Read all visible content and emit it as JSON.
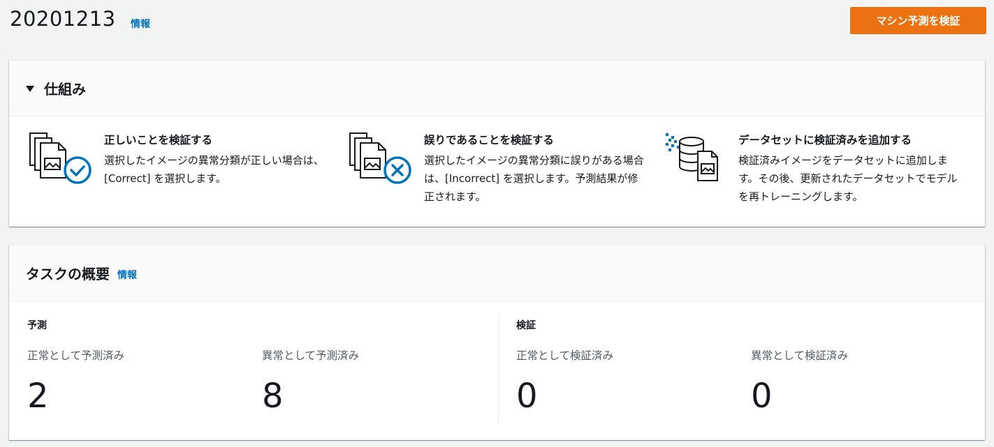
{
  "header": {
    "title": "20201213",
    "info": "情報",
    "action_button": "マシン予測を検証"
  },
  "how_it_works": {
    "title": "仕組み",
    "steps": [
      {
        "icon": "verify-correct-icon",
        "title": "正しいことを検証する",
        "description": "選択したイメージの異常分類が正しい場合は、[Correct] を選択します。"
      },
      {
        "icon": "verify-incorrect-icon",
        "title": "誤りであることを検証する",
        "description": "選択したイメージの異常分類に誤りがある場合は、[Incorrect] を選択します。予測結果が修正されます。"
      },
      {
        "icon": "add-to-dataset-icon",
        "title": "データセットに検証済みを追加する",
        "description": "検証済みイメージをデータセットに追加します。その後、更新されたデータセットでモデルを再トレーニングします。"
      }
    ]
  },
  "task_overview": {
    "title": "タスクの概要",
    "info": "情報",
    "prediction": {
      "label": "予測",
      "normal_label": "正常として予測済み",
      "normal_value": "2",
      "anomaly_label": "異常として予測済み",
      "anomaly_value": "8"
    },
    "verification": {
      "label": "検証",
      "normal_label": "正常として検証済み",
      "normal_value": "0",
      "anomaly_label": "異常として検証済み",
      "anomaly_value": "0"
    }
  },
  "colors": {
    "accent": "#ec7211",
    "link": "#0073bb",
    "icon_blue": "#0073bb"
  }
}
